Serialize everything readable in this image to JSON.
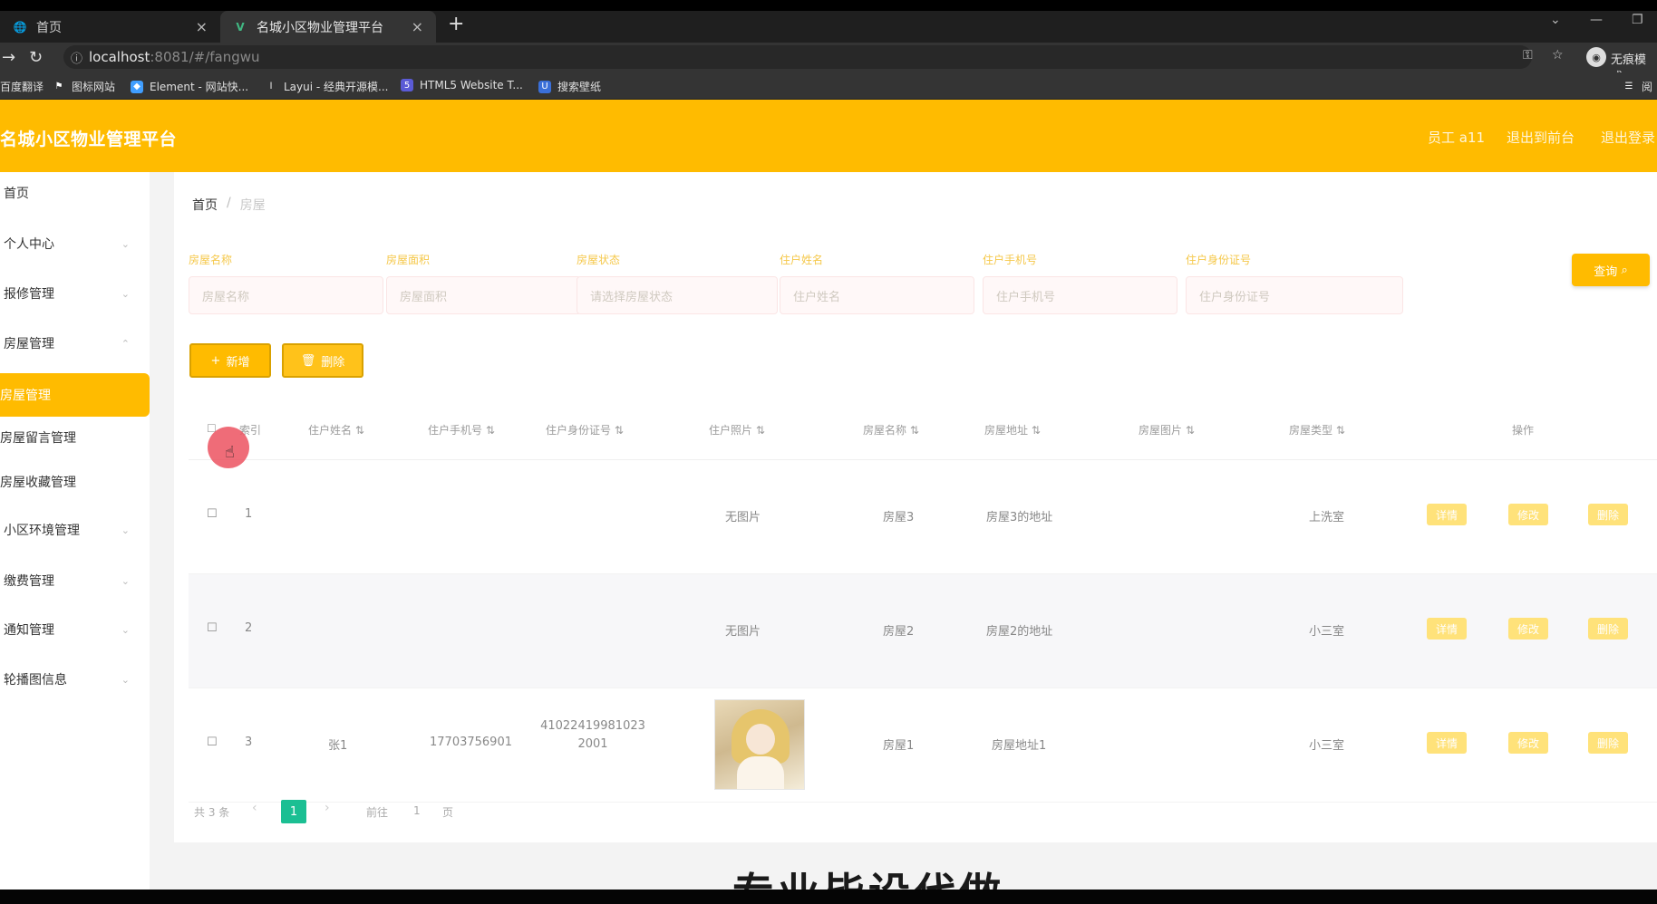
{
  "browser": {
    "tabs": [
      {
        "title": "首页",
        "icon": "globe-icon"
      },
      {
        "title": "名城小区物业管理平台",
        "icon": "vue-icon"
      }
    ],
    "url_host": "localhost",
    "url_rest": ":8081/#/fangwu",
    "incognito_label": "无痕模式",
    "right_cut_label": "阅",
    "bookmarks": [
      "百度翻译",
      "图标网站",
      "Element - 网站快...",
      "Layui - 经典开源模...",
      "HTML5 Website T...",
      "搜索壁纸"
    ]
  },
  "header": {
    "title": "名城小区物业管理平台",
    "user": "员工 a11",
    "back_front": "退出到前台",
    "logout": "退出登录"
  },
  "sidebar": {
    "items": [
      {
        "label": "首页"
      },
      {
        "label": "个人中心"
      },
      {
        "label": "报修管理"
      },
      {
        "label": "房屋管理"
      },
      {
        "label": "房屋管理"
      },
      {
        "label": "房屋留言管理"
      },
      {
        "label": "房屋收藏管理"
      },
      {
        "label": "小区环境管理"
      },
      {
        "label": "缴费管理"
      },
      {
        "label": "通知管理"
      },
      {
        "label": "轮播图信息"
      }
    ]
  },
  "breadcrumb": {
    "home": "首页",
    "sep": "/",
    "current": "房屋"
  },
  "search": {
    "fields": [
      {
        "label": "房屋名称",
        "placeholder": "房屋名称"
      },
      {
        "label": "房屋面积",
        "placeholder": "房屋面积"
      },
      {
        "label": "房屋状态",
        "placeholder": "请选择房屋状态"
      },
      {
        "label": "住户姓名",
        "placeholder": "住户姓名"
      },
      {
        "label": "住户手机号",
        "placeholder": "住户手机号"
      },
      {
        "label": "住户身份证号",
        "placeholder": "住户身份证号"
      }
    ],
    "button": "查询"
  },
  "actions": {
    "add": "新增",
    "delete": "删除"
  },
  "table": {
    "headers": [
      "索引",
      "住户姓名",
      "住户手机号",
      "住户身份证号",
      "住户照片",
      "房屋名称",
      "房屋地址",
      "房屋图片",
      "房屋类型",
      "操作"
    ],
    "rows": [
      {
        "index": "1",
        "name": "",
        "phone": "",
        "idcard": "",
        "photo": "无图片",
        "house": "房屋3",
        "address": "房屋3的地址",
        "type": "上洗室",
        "view": "详情",
        "edit": "修改",
        "del": "删除"
      },
      {
        "index": "2",
        "name": "",
        "phone": "",
        "idcard": "",
        "photo": "无图片",
        "house": "房屋2",
        "address": "房屋2的地址",
        "type": "小三室",
        "view": "详情",
        "edit": "修改",
        "del": "删除"
      },
      {
        "index": "3",
        "name": "张1",
        "phone": "17703756901",
        "idcard": "41022419981023 2001",
        "photo": "",
        "house": "房屋1",
        "address": "房屋地址1",
        "type": "小三室",
        "view": "详情",
        "edit": "修改",
        "del": "删除"
      }
    ]
  },
  "pagination": {
    "total": "共 3 条",
    "page": "1",
    "goto": "前往",
    "goto_value": "1",
    "unit": "页"
  },
  "overlay_text": "专业毕设代做",
  "colors": {
    "primary": "#ffbb00",
    "pager_active": "#1bbf93",
    "cursor": "#ec5260"
  }
}
